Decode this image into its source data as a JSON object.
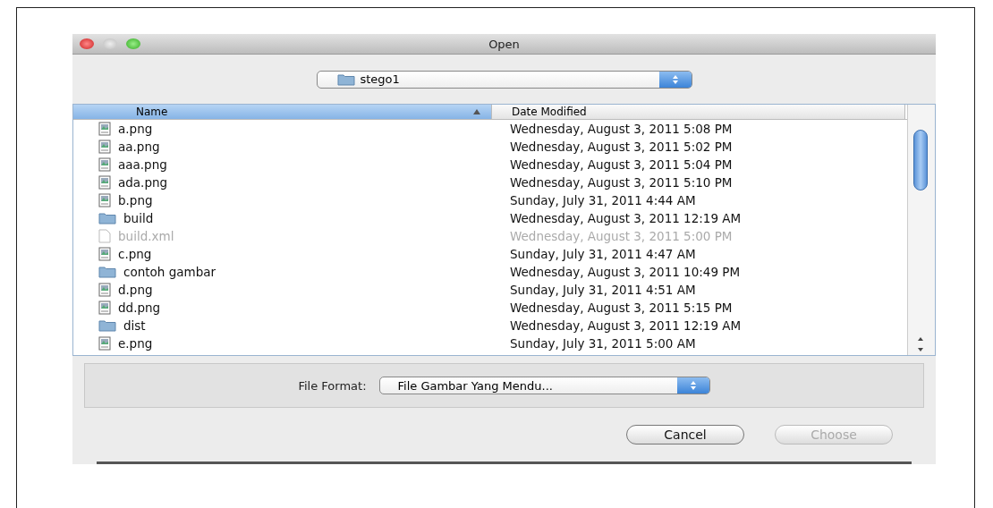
{
  "window": {
    "title": "Open"
  },
  "location": {
    "value": "stego1"
  },
  "table": {
    "columns": [
      {
        "label": "Name",
        "selected": true
      },
      {
        "label": "Date Modified",
        "selected": false
      }
    ],
    "rows": [
      {
        "name": "a.png",
        "date": "Wednesday, August 3, 2011 5:08 PM",
        "kind": "image",
        "disabled": false
      },
      {
        "name": "aa.png",
        "date": "Wednesday, August 3, 2011 5:02 PM",
        "kind": "image",
        "disabled": false
      },
      {
        "name": "aaa.png",
        "date": "Wednesday, August 3, 2011 5:04 PM",
        "kind": "image",
        "disabled": false
      },
      {
        "name": "ada.png",
        "date": "Wednesday, August 3, 2011 5:10 PM",
        "kind": "image",
        "disabled": false
      },
      {
        "name": "b.png",
        "date": "Sunday, July 31, 2011 4:44 AM",
        "kind": "image",
        "disabled": false
      },
      {
        "name": "build",
        "date": "Wednesday, August 3, 2011 12:19 AM",
        "kind": "folder",
        "disabled": false
      },
      {
        "name": "build.xml",
        "date": "Wednesday, August 3, 2011 5:00 PM",
        "kind": "file",
        "disabled": true
      },
      {
        "name": "c.png",
        "date": "Sunday, July 31, 2011 4:47 AM",
        "kind": "image",
        "disabled": false
      },
      {
        "name": "contoh gambar",
        "date": "Wednesday, August 3, 2011 10:49 PM",
        "kind": "folder",
        "disabled": false
      },
      {
        "name": "d.png",
        "date": "Sunday, July 31, 2011 4:51 AM",
        "kind": "image",
        "disabled": false
      },
      {
        "name": "dd.png",
        "date": "Wednesday, August 3, 2011 5:15 PM",
        "kind": "image",
        "disabled": false
      },
      {
        "name": "dist",
        "date": "Wednesday, August 3, 2011 12:19 AM",
        "kind": "folder",
        "disabled": false
      },
      {
        "name": "e.png",
        "date": "Sunday, July 31, 2011 5:00 AM",
        "kind": "image",
        "disabled": false
      }
    ]
  },
  "file_format": {
    "label": "File Format:",
    "value": "File Gambar Yang Mendu..."
  },
  "buttons": [
    {
      "label": "Cancel",
      "disabled": false
    },
    {
      "label": "Choose",
      "disabled": true
    }
  ]
}
